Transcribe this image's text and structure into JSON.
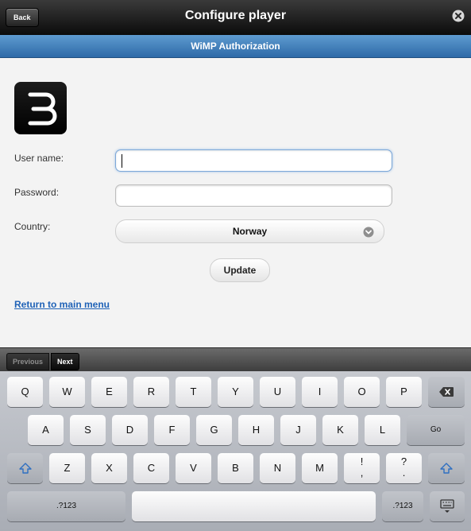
{
  "header": {
    "back_label": "Back",
    "title": "Configure player",
    "subtitle": "WiMP Authorization"
  },
  "form": {
    "username_label": "User name:",
    "password_label": "Password:",
    "country_label": "Country:",
    "country_value": "Norway",
    "update_label": "Update",
    "return_link": "Return to main menu"
  },
  "keyboard_toolbar": {
    "previous_label": "Previous",
    "next_label": "Next"
  },
  "keyboard": {
    "row1": [
      "Q",
      "W",
      "E",
      "R",
      "T",
      "Y",
      "U",
      "I",
      "O",
      "P"
    ],
    "row2": [
      "A",
      "S",
      "D",
      "F",
      "G",
      "H",
      "J",
      "K",
      "L"
    ],
    "go_label": "Go",
    "row3": [
      "Z",
      "X",
      "C",
      "V",
      "B",
      "N",
      "M"
    ],
    "punct1_top": "!",
    "punct1_bottom": ",",
    "punct2_top": "?",
    "punct2_bottom": ".",
    "numbers_label_left": ".?123",
    "numbers_label_right": ".?123"
  },
  "colors": {
    "accent_blue": "#3a78b8",
    "link_blue": "#1f62b7",
    "top_bar": "#1a1a1a"
  }
}
